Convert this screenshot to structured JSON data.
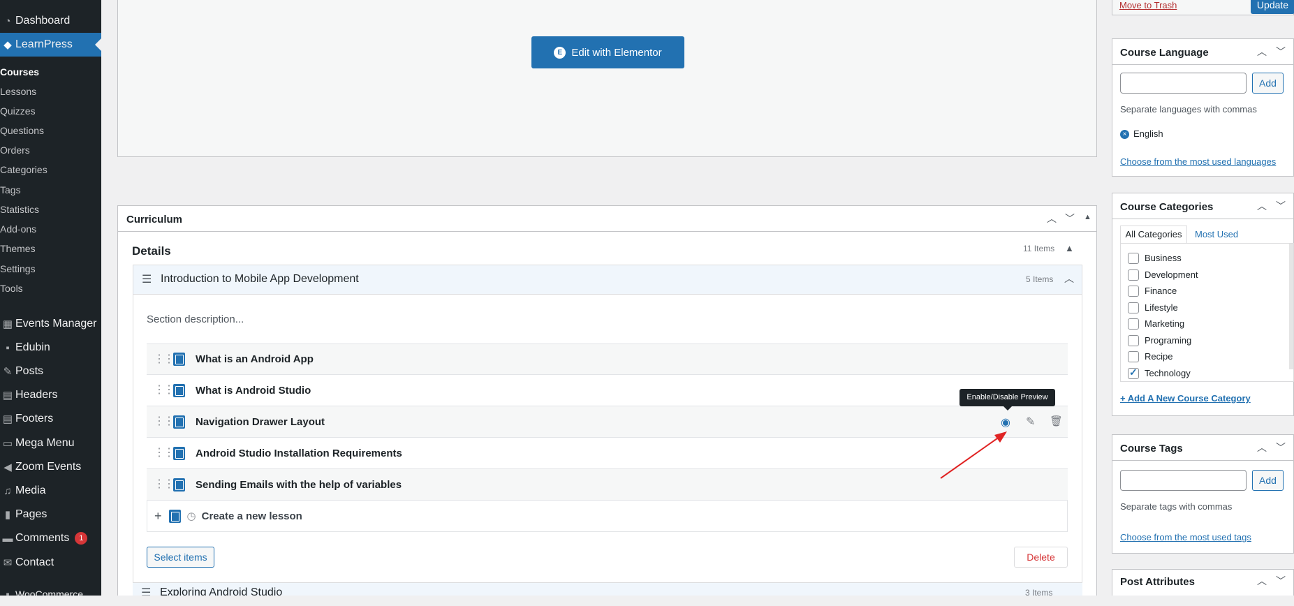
{
  "sidebar": {
    "top_items": [
      {
        "label": "Dashboard",
        "icon": "dashboard-icon"
      },
      {
        "label": "LearnPress",
        "icon": "learnpress-icon"
      }
    ],
    "learnpress_sub": [
      "Courses",
      "Lessons",
      "Quizzes",
      "Questions",
      "Orders",
      "Categories",
      "Tags",
      "Statistics",
      "Add-ons",
      "Themes",
      "Settings",
      "Tools"
    ],
    "items": [
      {
        "label": "Events Manager",
        "icon": "calendar-icon"
      },
      {
        "label": "Edubin",
        "icon": "theme-icon"
      },
      {
        "label": "Posts",
        "icon": "pin-icon"
      },
      {
        "label": "Headers",
        "icon": "table-icon"
      },
      {
        "label": "Footers",
        "icon": "table-icon"
      },
      {
        "label": "Mega Menu",
        "icon": "menu-icon"
      },
      {
        "label": "Zoom Events",
        "icon": "video-icon"
      },
      {
        "label": "Media",
        "icon": "media-icon"
      },
      {
        "label": "Pages",
        "icon": "page-icon"
      },
      {
        "label": "Comments",
        "icon": "comment-icon",
        "badge": "1"
      },
      {
        "label": "Contact",
        "icon": "mail-icon"
      },
      {
        "label": "WooCommerce",
        "icon": "woo-icon"
      }
    ]
  },
  "editor": {
    "elementor_button": "Edit with Elementor",
    "move_to_trash": "Move to Trash",
    "update": "Update"
  },
  "curriculum": {
    "title": "Curriculum",
    "details_label": "Details",
    "items_count": "11 Items",
    "section": {
      "title": "Introduction to Mobile App Development",
      "count": "5 Items",
      "description": "Section description...",
      "lessons": [
        "What is an Android App",
        "What is Android Studio",
        "Navigation Drawer Layout",
        "Android Studio Installation Requirements",
        "Sending Emails with the help of variables"
      ],
      "new_lesson_placeholder": "Create a new lesson",
      "select_items": "Select items",
      "delete": "Delete"
    },
    "next_section_title": "Exploring Android Studio",
    "next_section_count": "3 Items",
    "tooltip": "Enable/Disable Preview"
  },
  "course_language": {
    "title": "Course Language",
    "add": "Add",
    "hint": "Separate languages with commas",
    "tags": [
      "English"
    ],
    "choose_link": "Choose from the most used languages"
  },
  "course_categories": {
    "title": "Course Categories",
    "tab_all": "All Categories",
    "tab_used": "Most Used",
    "items": [
      {
        "label": "Business",
        "checked": false
      },
      {
        "label": "Development",
        "checked": false
      },
      {
        "label": "Finance",
        "checked": false
      },
      {
        "label": "Lifestyle",
        "checked": false
      },
      {
        "label": "Marketing",
        "checked": false
      },
      {
        "label": "Programing",
        "checked": false
      },
      {
        "label": "Recipe",
        "checked": false
      },
      {
        "label": "Technology",
        "checked": true
      }
    ],
    "add_link": "+ Add A New Course Category"
  },
  "course_tags": {
    "title": "Course Tags",
    "add": "Add",
    "hint": "Separate tags with commas",
    "choose_link": "Choose from the most used tags"
  },
  "post_attributes": {
    "title": "Post Attributes"
  },
  "colors": {
    "accent": "#2271b1",
    "sidebar": "#1d2327",
    "danger": "#d63638",
    "arrow": "#e02424"
  }
}
